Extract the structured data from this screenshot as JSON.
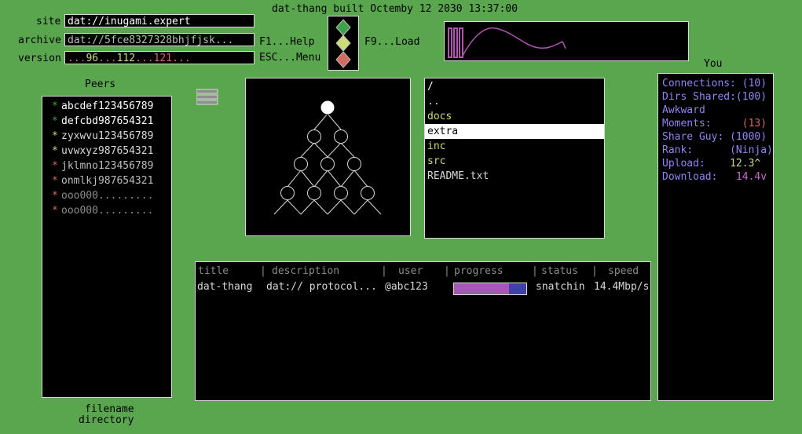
{
  "header": {
    "title": "dat-thang built Octemby 12 2030 13:37:00"
  },
  "fields": {
    "site_label": "site",
    "site_value": "dat://inugami.expert",
    "archive_label": "archive",
    "archive_value": "dat://5fce8327328bhjfjsk...",
    "version_label": "version",
    "version_parts": [
      "...",
      "96",
      "...",
      "112",
      "...",
      "121",
      "..."
    ]
  },
  "shortcuts": {
    "help": "F1...Help",
    "menu": "ESC...Menu",
    "load": "F9...Load"
  },
  "status_diamonds": {
    "colors": [
      "#3ea24a",
      "#cddc74",
      "#d46a60"
    ]
  },
  "peers": {
    "title": "Peers",
    "items": [
      {
        "name": "abcdef123456789",
        "star_color": "#3ea24a",
        "text_color": "#ffffff"
      },
      {
        "name": "defcbd987654321",
        "star_color": "#3ea24a",
        "text_color": "#ffffff"
      },
      {
        "name": "zyxwvu123456789",
        "star_color": "#cddc74",
        "text_color": "#d8d8d8"
      },
      {
        "name": "uvwxyz987654321",
        "star_color": "#cddc74",
        "text_color": "#d8d8d8"
      },
      {
        "name": "jklmno123456789",
        "star_color": "#d46a60",
        "text_color": "#bdbdbd"
      },
      {
        "name": "onmlkj987654321",
        "star_color": "#d46a60",
        "text_color": "#bdbdbd"
      },
      {
        "name": "ooo000.........",
        "star_color": "#d46a60",
        "text_color": "#8b8b8b"
      },
      {
        "name": "ooo000.........",
        "star_color": "#d46a60",
        "text_color": "#8b8b8b"
      }
    ]
  },
  "footer_labels": {
    "filename": "filename",
    "directory": "directory"
  },
  "files": {
    "entries": [
      "/",
      "..",
      "docs",
      "extra",
      "inc",
      "src",
      "README.txt"
    ],
    "selected_index": 3
  },
  "you": {
    "title": "You",
    "stats": [
      {
        "label": "Connections: ",
        "value": "(10)"
      },
      {
        "label": "Dirs Shared:",
        "value": "(100)"
      },
      {
        "label": "Awkward",
        "value": ""
      },
      {
        "label": "Moments:     ",
        "value": "(13)",
        "value_color": "#d46a60"
      },
      {
        "label": "Share Guy: ",
        "value": "(1000)"
      },
      {
        "label": "Rank:      ",
        "value": "(Ninja)"
      },
      {
        "label": "Upload:    ",
        "value": "12.3^",
        "value_color": "#cddc74"
      },
      {
        "label": "Download:   ",
        "value": "14.4v",
        "value_color": "#c968c9"
      }
    ]
  },
  "transfers": {
    "headers": [
      "title",
      "description",
      "user",
      "progress",
      "status",
      "speed"
    ],
    "rows": [
      {
        "title": "dat-thang",
        "description": "dat:// protocol...",
        "user": "@abc123",
        "progress": 0.76,
        "status": "snatchin",
        "speed": "14.4Mbp/s"
      }
    ]
  },
  "colors": {
    "bg": "#5aa64f",
    "wave": "#b055b0",
    "progress_fill": "#a35ab5",
    "progress_track": "#3f3fae",
    "highlight": "#ffffff",
    "dir_color": "#cddc74",
    "file_color": "#d8d8d8",
    "you_text": "#8f86f0"
  }
}
